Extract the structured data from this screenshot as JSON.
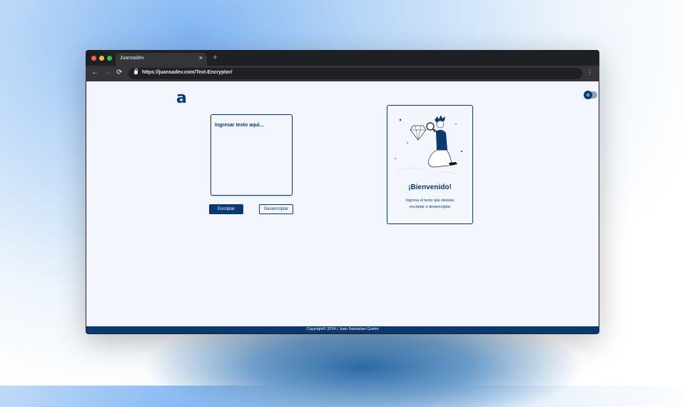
{
  "browser": {
    "tab_title": "Juansadev",
    "tab_close": "×",
    "new_tab": "+",
    "url": "https://juansadev.com/Text-Encryptor/",
    "nav_back": "←",
    "nav_forward": "→",
    "nav_reload": "⟳",
    "menu": "⋮"
  },
  "page": {
    "logo": "a",
    "textarea_placeholder": "Ingresar texto aquí...",
    "encrypt_label": "Encriptar",
    "decrypt_label": "Desencriptar",
    "card": {
      "title": "¡Bienvenido!",
      "text": "Ingresa el texto que deseas encriptar o desencriptar"
    },
    "footer": "Copyright© 2024 | Juan Sebastian Quieto"
  },
  "colors": {
    "brand": "#0a3871",
    "page_bg": "#f3f7fd"
  },
  "icons": {
    "theme_toggle": "theme-toggle-icon",
    "illustration": "person-with-magnifier-diamond-illustration"
  }
}
